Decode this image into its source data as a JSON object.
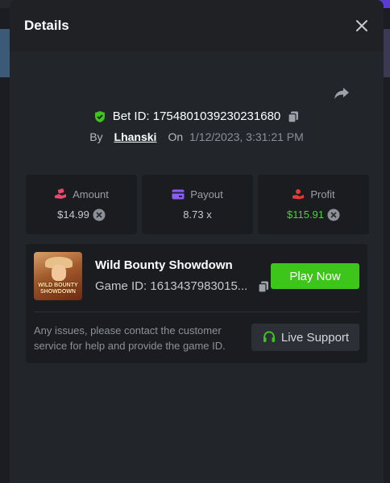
{
  "modal": {
    "title": "Details",
    "bet_id_label": "Bet ID: 1754801039230231680",
    "by_label": "By",
    "username": "Lhanski",
    "on_label": "On",
    "date": "1/12/2023, 3:31:21 PM"
  },
  "stats": [
    {
      "label": "Amount",
      "value": "$14.99",
      "icon": "hand-coin-icon",
      "color": "#e34a6b"
    },
    {
      "label": "Payout",
      "value": "8.73 x",
      "icon": "card-icon",
      "color": "#8b5cf6"
    },
    {
      "label": "Profit",
      "value": "$115.91",
      "icon": "hand-up-icon",
      "color": "#e53935"
    }
  ],
  "game": {
    "title": "Wild Bounty Showdown",
    "id_label": "Game ID: 1613437983015...",
    "thumbnail_text": "WILD BOUNTY SHOWDOWN",
    "play_label": "Play Now",
    "notice": "Any issues, please contact the customer service for help and provide the game ID.",
    "support_label": "Live Support"
  },
  "colors": {
    "accent_green": "#3ec51c",
    "profit_green": "#4bd03a",
    "modal_bg": "#22252a"
  }
}
